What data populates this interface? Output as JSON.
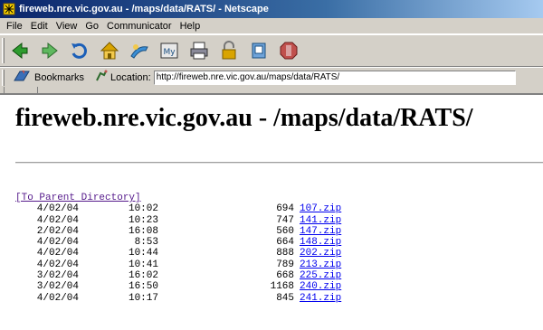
{
  "window": {
    "title": "fireweb.nre.vic.gov.au - /maps/data/RATS/ - Netscape"
  },
  "menu": [
    "File",
    "Edit",
    "View",
    "Go",
    "Communicator",
    "Help"
  ],
  "toolbar": {
    "buttons": [
      "back-icon",
      "forward-icon",
      "reload-icon",
      "home-icon",
      "search-icon",
      "my-netscape-icon",
      "print-icon",
      "security-icon",
      "shop-icon",
      "stop-icon"
    ]
  },
  "location_bar": {
    "bookmarks_label": "Bookmarks",
    "location_label": "Location:",
    "url": "http://fireweb.nre.vic.gov.au/maps/data/RATS/"
  },
  "page": {
    "heading": "fireweb.nre.vic.gov.au - /maps/data/RATS/",
    "parent_link": "[To Parent Directory]",
    "files": [
      {
        "date": "4/02/04",
        "time": "10:02",
        "size": "694",
        "name": "107.zip"
      },
      {
        "date": "4/02/04",
        "time": "10:23",
        "size": "747",
        "name": "141.zip"
      },
      {
        "date": "2/02/04",
        "time": "16:08",
        "size": "560",
        "name": "147.zip"
      },
      {
        "date": "4/02/04",
        "time": "8:53",
        "size": "664",
        "name": "148.zip"
      },
      {
        "date": "4/02/04",
        "time": "10:44",
        "size": "888",
        "name": "202.zip"
      },
      {
        "date": "4/02/04",
        "time": "10:41",
        "size": "789",
        "name": "213.zip"
      },
      {
        "date": "3/02/04",
        "time": "16:02",
        "size": "668",
        "name": "225.zip"
      },
      {
        "date": "3/02/04",
        "time": "16:50",
        "size": "1168",
        "name": "240.zip"
      },
      {
        "date": "4/02/04",
        "time": "10:17",
        "size": "845",
        "name": "241.zip"
      }
    ]
  },
  "colors": {
    "titlebar": "#0a246a",
    "chrome": "#d4d0c8",
    "link": "#0000ee",
    "visited_link": "#551a8b"
  }
}
